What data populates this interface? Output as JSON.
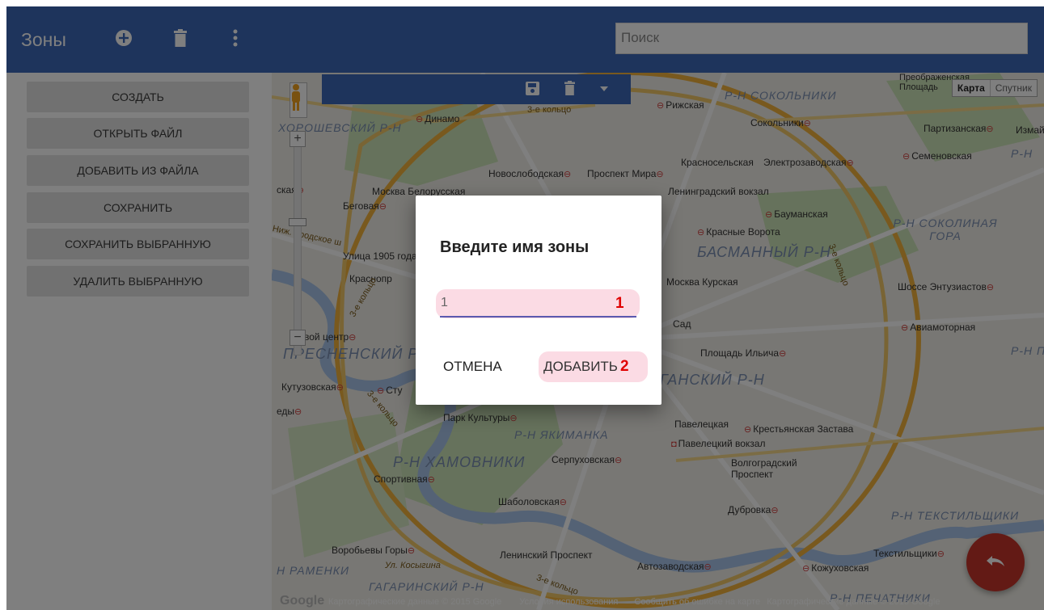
{
  "header": {
    "title": "Зоны",
    "search_placeholder": "Поиск"
  },
  "sidebar": {
    "items": [
      {
        "label": "СОЗДАТЬ"
      },
      {
        "label": "ОТКРЫТЬ ФАЙЛ"
      },
      {
        "label": "ДОБАВИТЬ ИЗ ФАЙЛА"
      },
      {
        "label": "СОХРАНИТЬ"
      },
      {
        "label": "СОХРАНИТЬ ВЫБРАННУЮ"
      },
      {
        "label": "УДАЛИТЬ ВЫБРАННУЮ"
      }
    ]
  },
  "map": {
    "type_map": "Карта",
    "type_satellite": "Спутник",
    "footer": {
      "data": "Картографические данные © 2015 Google",
      "terms": "Условия использования",
      "report": "Сообщить об ошибке на карте",
      "data2": "Картографические данные © 2015 Google"
    },
    "logo": "Google",
    "labels": [
      "Динамо",
      "Рижская",
      "Сокольники",
      "Партизанская",
      "Измайл",
      "Новослободская",
      "Проспект Мира",
      "Красносельская",
      "Электрозаводская",
      "Семеновская",
      "Москва Белорусская",
      "Беговая",
      "Ленинградский вокзал",
      "Бауманская",
      "Красные Ворота",
      "Улица 1905 года",
      "Краснопр",
      "Москва Курская",
      "Шоссе Энтузиастов",
      "Авиамоторная",
      "Сад",
      "Площадь Ильича",
      "вой центр",
      "Кутузовская",
      "Сту",
      "Парк Культуры",
      "Павелецкая",
      "Крестьянская Застава",
      "Павелецкий вокзал",
      "Серпуховская",
      "Волгоградский Проспект",
      "Спортивная",
      "Шаболовская",
      "Дубровка",
      "Воробьевы Горы",
      "Ленинский Проспект",
      "Автозаводская",
      "Кожуховская",
      "Текстильщики",
      "Преображенская Площадь",
      "ская",
      "еды"
    ],
    "districts": [
      "Р-Н СОКОЛЬНИКИ",
      "ХОРОШЕВСКИЙ Р-Н",
      "Р-Н СОКОЛИНАЯ ГОРА",
      "БАСМАННЫЙ Р-Н",
      "ПРЕСНЕНСКИЙ Р",
      "ГАНСКИЙ Р-Н",
      "Р-Н ЯКИМАНКА",
      "Р-Н ХАМОВНИКИ",
      "Р-Н ТЕКСТИЛЬЩИКИ",
      "Н РАМЕНКИ",
      "ГАГАРИНСКИЙ Р-Н",
      "Р-Н ПЕЧАТНИКИ",
      "Р-Н П",
      "Р-Н"
    ],
    "roads": [
      "3-е кольцо",
      "3-е кольцо",
      "3-е кольцо",
      "3-е кольцо",
      "3-е кольцо",
      "Ул. Косыгина",
      "Ниж. Кродское ш"
    ]
  },
  "dialog": {
    "title": "Введите имя зоны",
    "input_value": "1",
    "badge1": "1",
    "cancel": "ОТМЕНА",
    "add": "ДОБАВИТЬ",
    "badge2": "2"
  },
  "icons": {
    "add": "plus-circle-icon",
    "delete": "trash-icon",
    "menu": "more-vert-icon",
    "save": "save-icon",
    "dropdown": "caret-down-icon",
    "undo": "undo-icon",
    "pegman": "pegman-icon"
  },
  "colors": {
    "primary": "#3d69b9",
    "fab": "#c7352a",
    "highlight": "#fbdbe4",
    "badge": "#e00000"
  }
}
